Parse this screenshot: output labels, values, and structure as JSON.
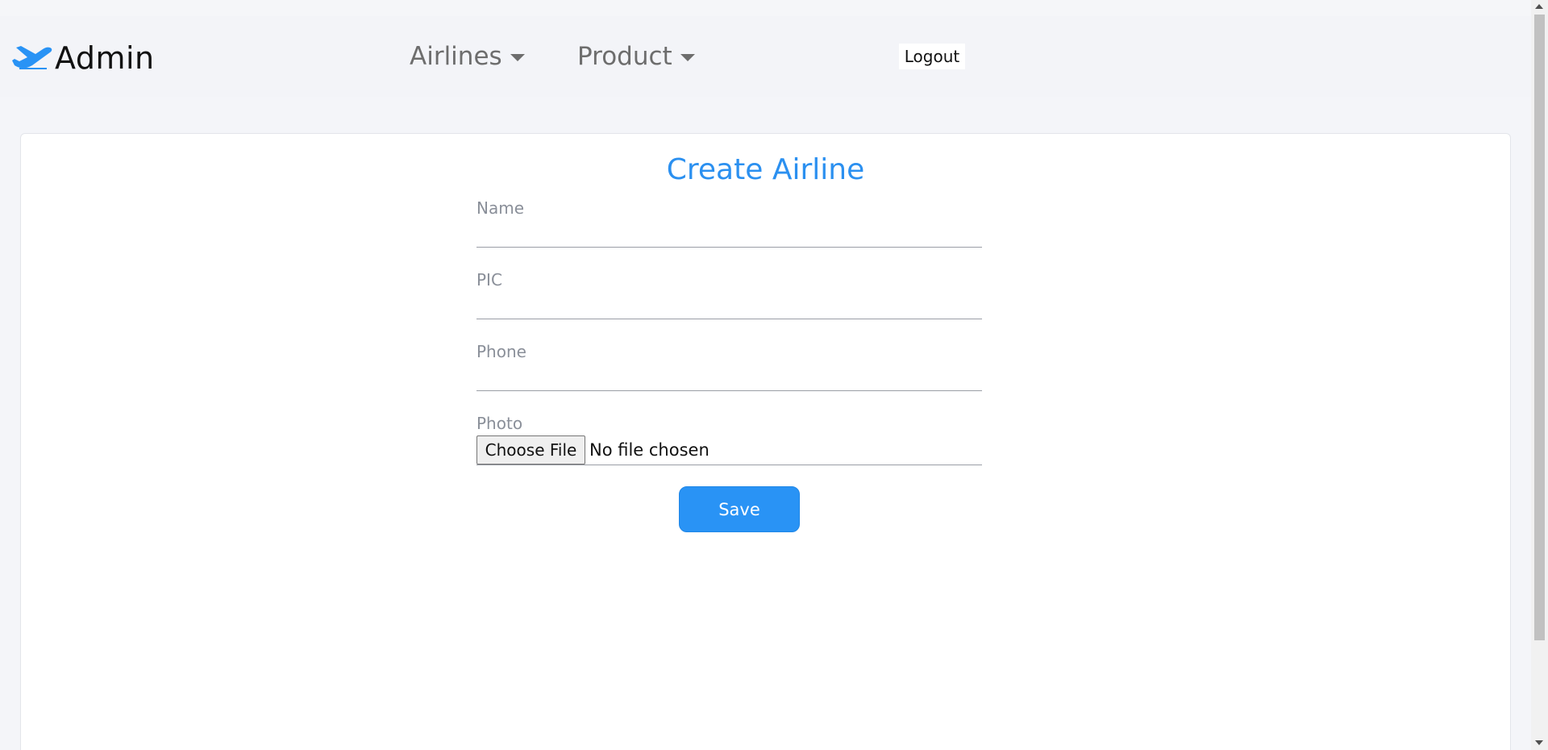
{
  "brand": {
    "icon": "airplane-icon",
    "label": "Admin"
  },
  "nav": {
    "airlines_label": "Airlines",
    "product_label": "Product",
    "logout_label": "Logout"
  },
  "form": {
    "title": "Create Airline",
    "name_label": "Name",
    "name_value": "",
    "pic_label": "PIC",
    "pic_value": "",
    "phone_label": "Phone",
    "phone_value": "",
    "photo_label": "Photo",
    "file_button_label": "Choose File",
    "file_status": "No file chosen",
    "save_label": "Save"
  },
  "colors": {
    "accent": "#2993f5",
    "title": "#2b90f0",
    "background": "#f4f5f9",
    "card": "#ffffff"
  }
}
